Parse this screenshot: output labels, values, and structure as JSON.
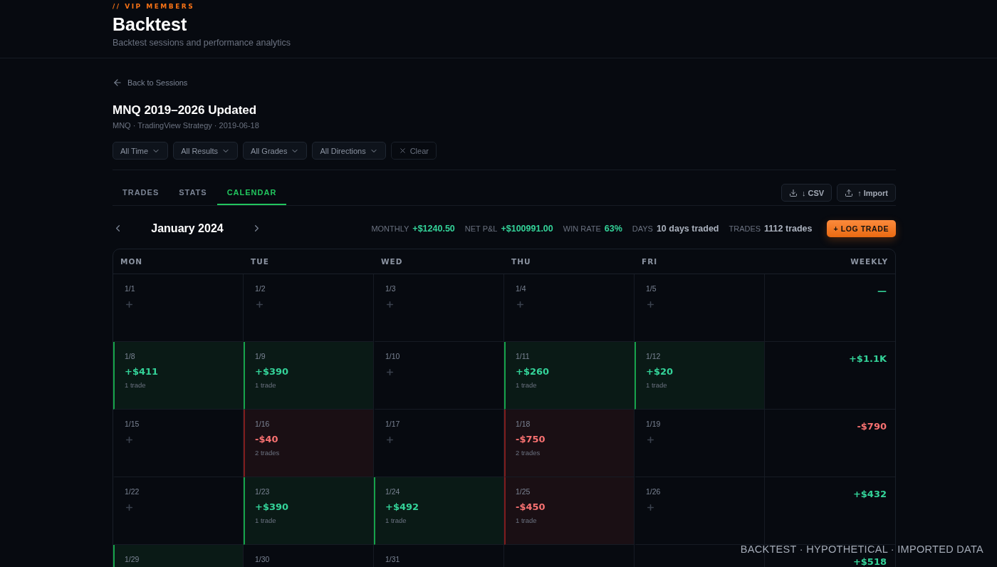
{
  "header": {
    "eyebrow": "// VIP MEMBERS",
    "title": "Backtest",
    "subtitle": "Backtest sessions and performance analytics"
  },
  "back_link": "Back to Sessions",
  "session": {
    "title": "MNQ 2019–2026 Updated",
    "meta": "MNQ · TradingView Strategy · 2019-06-18"
  },
  "filters": [
    {
      "label": "All Time",
      "kind": "dropdown"
    },
    {
      "label": "All Results",
      "kind": "dropdown"
    },
    {
      "label": "All Grades",
      "kind": "dropdown"
    },
    {
      "label": "All Directions",
      "kind": "dropdown"
    },
    {
      "label": "Clear",
      "kind": "clear"
    }
  ],
  "tabs": [
    {
      "label": "TRADES",
      "selected": false
    },
    {
      "label": "STATS",
      "selected": false
    },
    {
      "label": "CALENDAR",
      "selected": true
    }
  ],
  "actions": [
    {
      "label": "↓ CSV",
      "kind": "download"
    },
    {
      "label": "↑ Import",
      "kind": "upload"
    }
  ],
  "month": "January 2024",
  "stats": [
    {
      "label": "MONTHLY",
      "value": "+$1240.50",
      "kind": "gain"
    },
    {
      "label": "NET P&L",
      "value": "+$100991.00",
      "kind": "gain"
    },
    {
      "label": "WIN RATE",
      "value": "63%",
      "kind": "gain"
    },
    {
      "label": "DAYS",
      "value": "10 days traded",
      "kind": "plain"
    },
    {
      "label": "TRADES",
      "value": "1112 trades",
      "kind": "plain"
    }
  ],
  "log_button": "+ LOG TRADE",
  "calendar": {
    "columns": [
      "MON",
      "TUE",
      "WED",
      "THU",
      "FRI",
      "WEEKLY"
    ],
    "weeks": [
      {
        "days": [
          {
            "date": "1/1",
            "kind": "none"
          },
          {
            "date": "1/2",
            "kind": "none"
          },
          {
            "date": "1/3",
            "kind": "none"
          },
          {
            "date": "1/4",
            "kind": "none"
          },
          {
            "date": "1/5",
            "kind": "none"
          }
        ],
        "weekly": {
          "text": "—",
          "kind": "win"
        }
      },
      {
        "days": [
          {
            "date": "1/8",
            "kind": "win",
            "pnl": "+$411",
            "trades": "1 trade"
          },
          {
            "date": "1/9",
            "kind": "win",
            "pnl": "+$390",
            "trades": "1 trade"
          },
          {
            "date": "1/10",
            "kind": "none"
          },
          {
            "date": "1/11",
            "kind": "win",
            "pnl": "+$260",
            "trades": "1 trade"
          },
          {
            "date": "1/12",
            "kind": "win",
            "pnl": "+$20",
            "trades": "1 trade"
          }
        ],
        "weekly": {
          "text": "+$1.1K",
          "kind": "win"
        }
      },
      {
        "days": [
          {
            "date": "1/15",
            "kind": "none"
          },
          {
            "date": "1/16",
            "kind": "loss",
            "pnl": "-$40",
            "trades": "2 trades"
          },
          {
            "date": "1/17",
            "kind": "none"
          },
          {
            "date": "1/18",
            "kind": "loss",
            "pnl": "-$750",
            "trades": "2 trades"
          },
          {
            "date": "1/19",
            "kind": "none"
          }
        ],
        "weekly": {
          "text": "-$790",
          "kind": "loss"
        }
      },
      {
        "days": [
          {
            "date": "1/22",
            "kind": "none"
          },
          {
            "date": "1/23",
            "kind": "win",
            "pnl": "+$390",
            "trades": "1 trade"
          },
          {
            "date": "1/24",
            "kind": "win",
            "pnl": "+$492",
            "trades": "1 trade"
          },
          {
            "date": "1/25",
            "kind": "loss",
            "pnl": "-$450",
            "trades": "1 trade"
          },
          {
            "date": "1/26",
            "kind": "none"
          }
        ],
        "weekly": {
          "text": "+$432",
          "kind": "win"
        }
      },
      {
        "days": [
          {
            "date": "1/29",
            "kind": "win"
          },
          {
            "date": "1/30",
            "kind": "dateonly"
          },
          {
            "date": "1/31",
            "kind": "dateonly"
          },
          {
            "kind": "blank"
          },
          {
            "kind": "blank"
          }
        ],
        "weekly": {
          "text": "+$518",
          "kind": "win"
        }
      }
    ]
  },
  "disclaimer": "BACKTEST · HYPOTHETICAL · IMPORTED DATA"
}
